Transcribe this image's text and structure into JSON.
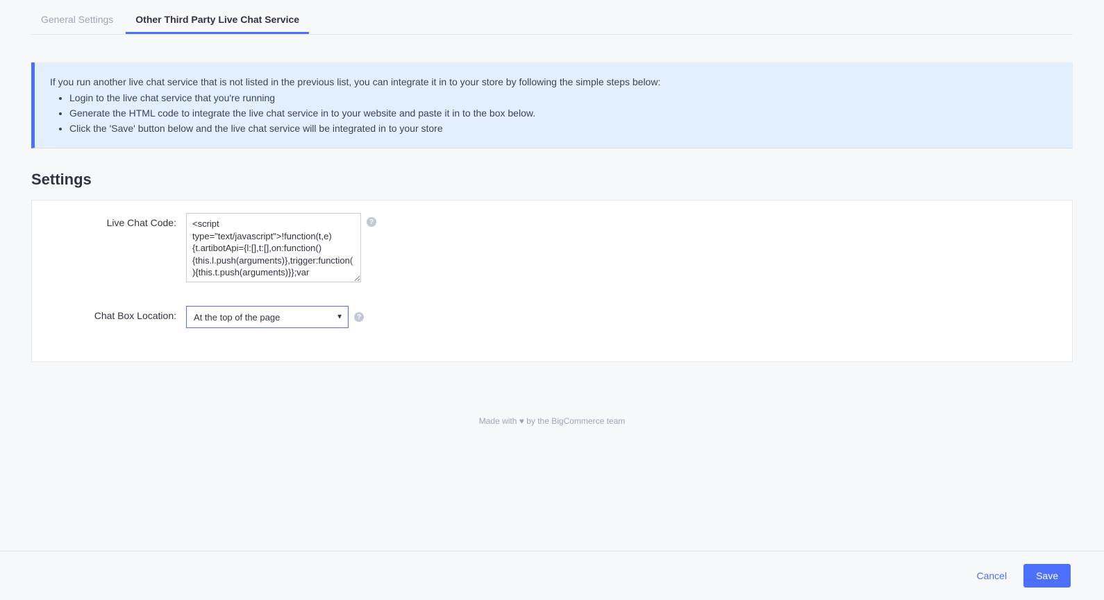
{
  "tabs": {
    "general": "General Settings",
    "other": "Other Third Party Live Chat Service"
  },
  "info": {
    "intro": "If you run another live chat service that is not listed in the previous list, you can integrate it in to your store by following the simple steps below:",
    "step1": "Login to the live chat service that you're running",
    "step2": "Generate the HTML code to integrate the live chat service in to your website and paste it in to the box below.",
    "step3": "Click the 'Save' button below and the live chat service will be integrated in to your store"
  },
  "section_title": "Settings",
  "form": {
    "code_label": "Live Chat Code:",
    "code_value": "<script type=\"text/javascript\">!function(t,e){t.artibotApi={l:[],t:[],on:function(){this.l.push(arguments)},trigger:function(){this.t.push(arguments)}};var",
    "location_label": "Chat Box Location:",
    "location_value": "At the top of the page"
  },
  "credit": {
    "prefix": "Made with ",
    "suffix": " by the BigCommerce team"
  },
  "actions": {
    "cancel": "Cancel",
    "save": "Save"
  }
}
